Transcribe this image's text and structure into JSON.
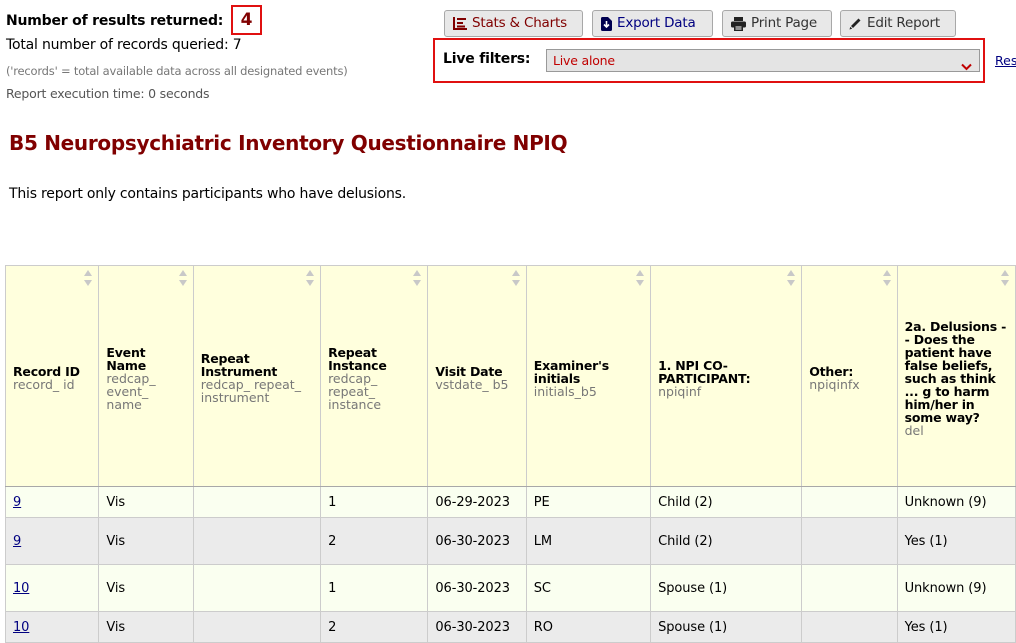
{
  "summary": {
    "results_label": "Number of results returned:",
    "results_count": "4",
    "total_label": "Total number of records queried: 7",
    "records_note": "('records' = total available data across all designated events)",
    "execution_time": "Report execution time: 0 seconds"
  },
  "toolbar": {
    "stats_label": "Stats & Charts",
    "export_label": "Export Data",
    "print_label": "Print Page",
    "edit_label": "Edit Report"
  },
  "live_filters": {
    "label": "Live filters:",
    "selected": "Live alone",
    "reset_link": "Res"
  },
  "report": {
    "title": "B5 Neuropsychiatric Inventory Questionnaire NPIQ",
    "description": "This report only contains participants who have delusions."
  },
  "table": {
    "columns": [
      {
        "label": "Record ID",
        "var": "record_ id"
      },
      {
        "label": "Event Name",
        "var": "redcap_ event_ name"
      },
      {
        "label": "Repeat Instrument",
        "var": "redcap_ repeat_ instrument"
      },
      {
        "label": "Repeat Instance",
        "var": "redcap_ repeat_ instance"
      },
      {
        "label": "Visit Date",
        "var": "vstdate_ b5"
      },
      {
        "label": "Examiner's initials",
        "var": "initials_b5"
      },
      {
        "label": "1. NPI CO-PARTICIPANT:",
        "var": "npiqinf"
      },
      {
        "label": "Other:",
        "var": "npiqinfx"
      },
      {
        "label": "2a. Delusions -- Does the patient have false beliefs, such as think ... g to harm him/her in some way?",
        "var": "del"
      }
    ],
    "rows": [
      {
        "record_id": "9",
        "event": "Vis",
        "repeat_instrument": "",
        "repeat_instance": "1",
        "visit_date": "06-29-2023",
        "initials": "PE",
        "coparticipant": "Child (2)",
        "other": "",
        "delusions": "Unknown (9)"
      },
      {
        "record_id": "9",
        "event": "Vis",
        "repeat_instrument": "",
        "repeat_instance": "2",
        "visit_date": "06-30-2023",
        "initials": "LM",
        "coparticipant": "Child (2)",
        "other": "",
        "delusions": "Yes (1)"
      },
      {
        "record_id": "10",
        "event": "Vis",
        "repeat_instrument": "",
        "repeat_instance": "1",
        "visit_date": "06-30-2023",
        "initials": "SC",
        "coparticipant": "Spouse (1)",
        "other": "",
        "delusions": "Unknown (9)"
      },
      {
        "record_id": "10",
        "event": "Vis",
        "repeat_instrument": "",
        "repeat_instance": "2",
        "visit_date": "06-30-2023",
        "initials": "RO",
        "coparticipant": "Spouse (1)",
        "other": "",
        "delusions": "Yes (1)"
      }
    ]
  },
  "colors": {
    "accent": "#800000",
    "highlight_border": "#e01010",
    "header_bg": "#ffffdd",
    "link": "#000080"
  }
}
